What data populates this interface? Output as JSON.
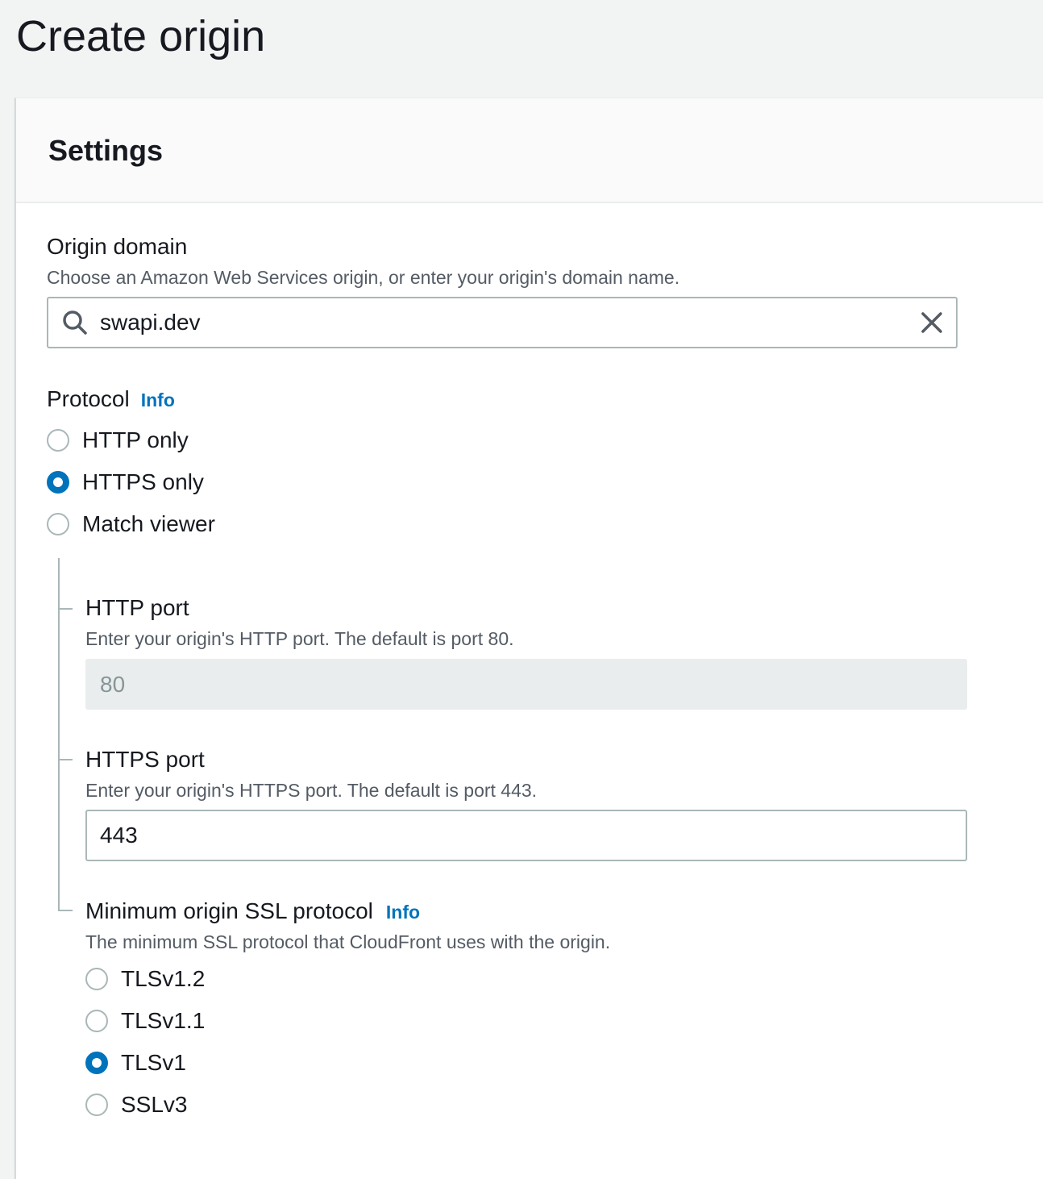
{
  "page": {
    "title": "Create origin"
  },
  "settings": {
    "title": "Settings",
    "origin_domain": {
      "label": "Origin domain",
      "description": "Choose an Amazon Web Services origin, or enter your origin's domain name.",
      "value": "swapi.dev",
      "icon": "search-icon",
      "clear_icon": "close-icon"
    },
    "protocol": {
      "label": "Protocol",
      "info": "Info",
      "options": [
        {
          "label": "HTTP only",
          "checked": false
        },
        {
          "label": "HTTPS only",
          "checked": true
        },
        {
          "label": "Match viewer",
          "checked": false
        }
      ]
    },
    "http_port": {
      "label": "HTTP port",
      "description": "Enter your origin's HTTP port. The default is port 80.",
      "value": "80",
      "disabled": true
    },
    "https_port": {
      "label": "HTTPS port",
      "description": "Enter your origin's HTTPS port. The default is port 443.",
      "value": "443"
    },
    "min_ssl": {
      "label": "Minimum origin SSL protocol",
      "info": "Info",
      "description": "The minimum SSL protocol that CloudFront uses with the origin.",
      "options": [
        {
          "label": "TLSv1.2",
          "checked": false
        },
        {
          "label": "TLSv1.1",
          "checked": false
        },
        {
          "label": "TLSv1",
          "checked": true
        },
        {
          "label": "SSLv3",
          "checked": false
        }
      ]
    }
  },
  "colors": {
    "accent": "#0073bb",
    "background": "#f2f3f3",
    "text": "#16191f",
    "secondary_text": "#545b64",
    "border": "#aab7b8"
  }
}
